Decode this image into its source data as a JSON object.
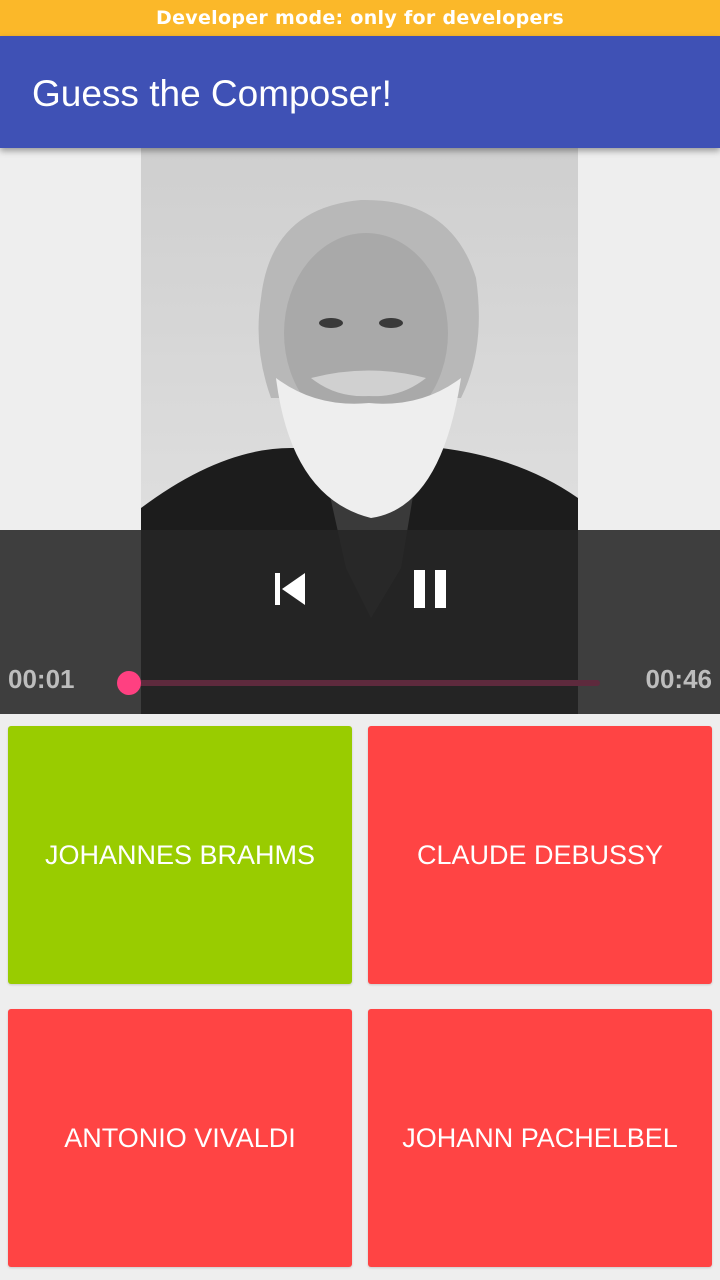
{
  "status_banner": {
    "text": "Developer mode: only for developers",
    "color": "#fbb829"
  },
  "app_bar": {
    "title": "Guess the Composer!",
    "color": "#3f51b5"
  },
  "player": {
    "current_time": "00:01",
    "duration": "00:46",
    "progress_fraction": 0.0,
    "controls": [
      "skip-previous-icon",
      "pause-icon"
    ]
  },
  "answers": [
    {
      "label": "JOHANNES BRAHMS",
      "color": "#99cc00"
    },
    {
      "label": "CLAUDE DEBUSSY",
      "color": "#ff4444"
    },
    {
      "label": "ANTONIO VIVALDI",
      "color": "#ff4444"
    },
    {
      "label": "JOHANN PACHELBEL",
      "color": "#ff4444"
    }
  ]
}
